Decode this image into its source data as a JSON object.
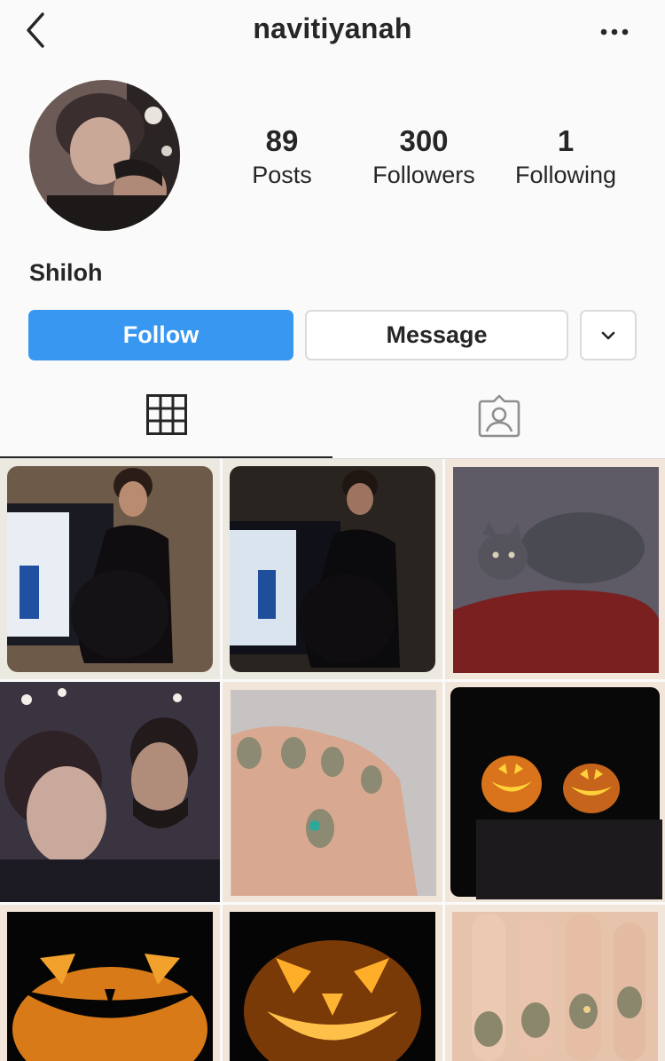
{
  "profile": {
    "username": "navitiyanah",
    "display_name": "Shiloh",
    "stats": [
      {
        "value": "89",
        "label": "Posts"
      },
      {
        "value": "300",
        "label": "Followers"
      },
      {
        "value": "1",
        "label": "Following"
      }
    ]
  },
  "actions": {
    "follow_label": "Follow",
    "message_label": "Message"
  },
  "tabs": [
    {
      "icon": "grid-icon",
      "active": true
    },
    {
      "icon": "tagged-icon",
      "active": false
    }
  ],
  "posts": [
    {
      "description": "pregnant woman in front of FBI screen"
    },
    {
      "description": "pregnant woman in front of FBI screen, darker"
    },
    {
      "description": "tabby kitten on red blanket"
    },
    {
      "description": "couple selfie with lights"
    },
    {
      "description": "painted nails with flower"
    },
    {
      "description": "two jack-o-lanterns"
    },
    {
      "description": "jack-o-lantern close-up"
    },
    {
      "description": "jack-o-lantern close-up"
    },
    {
      "description": "painted nails close-up"
    }
  ],
  "colors": {
    "accent": "#3897f0",
    "text": "#262626",
    "border": "#dbdbdb",
    "background": "#fafafa"
  }
}
